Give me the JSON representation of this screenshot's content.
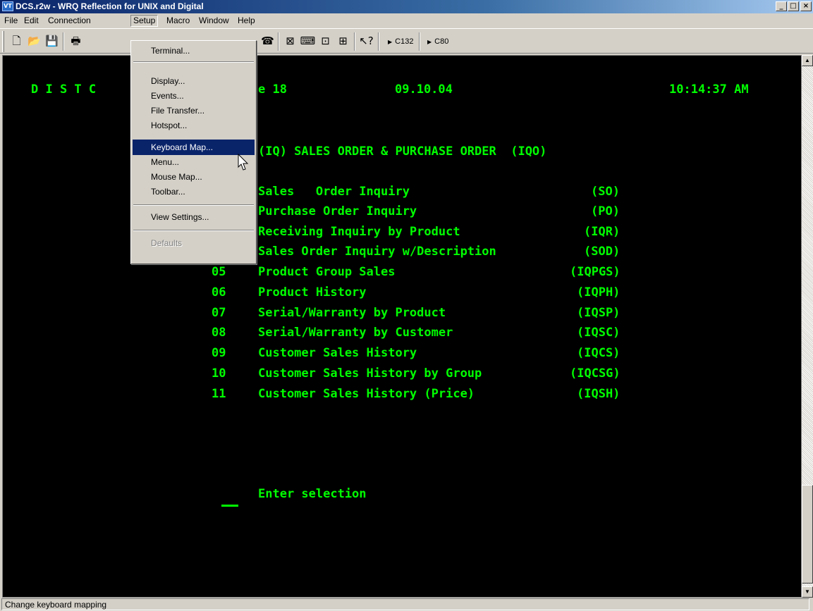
{
  "window": {
    "title": "DCS.r2w - WRQ Reflection for UNIX and Digital",
    "app_icon_text": "VT",
    "minimize": "_",
    "maximize": "□",
    "close": "×"
  },
  "menubar": [
    "File",
    "Edit",
    "Connection",
    "Setup",
    "Macro",
    "Window",
    "Help"
  ],
  "toolbar": {
    "buttons": [
      "new-icon",
      "open-icon",
      "save-icon",
      "print-icon",
      "connect-icon",
      "hotspot-icon",
      "keyboard-icon",
      "display-icon",
      "mouse-icon",
      "window-icon",
      "help-icon"
    ],
    "c132_label": "C132",
    "c80_label": "C80"
  },
  "setup_menu": {
    "items": [
      {
        "label": "Terminal..."
      },
      {
        "label": "Display..."
      },
      {
        "label": "Events..."
      },
      {
        "label": "File Transfer..."
      },
      {
        "label": "Hotspot..."
      },
      {
        "label": "Keyboard Map..."
      },
      {
        "label": "Menu..."
      },
      {
        "label": "Mouse Map..."
      },
      {
        "label": "Toolbar..."
      },
      {
        "label": "View Settings..."
      },
      {
        "label": "Defaults"
      }
    ],
    "active": "Keyboard Map..."
  },
  "terminal": {
    "header_left": "D I S T C",
    "header_mid": "e 18",
    "date": "09.10.04",
    "time": "10:14:37 AM",
    "menu_title": "(IQ) SALES ORDER & PURCHASE ORDER  (IQO)",
    "options": [
      {
        "num": "",
        "label": "Sales   Order Inquiry",
        "code": "(SO)"
      },
      {
        "num": "",
        "label": "Purchase Order Inquiry",
        "code": "(PO)"
      },
      {
        "num": "",
        "label": "Receiving Inquiry by Product",
        "code": "(IQR)"
      },
      {
        "num": "",
        "label": "Sales Order Inquiry w/Description",
        "code": "(SOD)"
      },
      {
        "num": "05",
        "label": "Product Group Sales",
        "code": "(IQPGS)"
      },
      {
        "num": "06",
        "label": "Product History",
        "code": "(IQPH)"
      },
      {
        "num": "07",
        "label": "Serial/Warranty by Product",
        "code": "(IQSP)"
      },
      {
        "num": "08",
        "label": "Serial/Warranty by Customer",
        "code": "(IQSC)"
      },
      {
        "num": "09",
        "label": "Customer Sales History",
        "code": "(IQCS)"
      },
      {
        "num": "10",
        "label": "Customer Sales History by Group",
        "code": "(IQCSG)"
      },
      {
        "num": "11",
        "label": "Customer Sales History (Price)",
        "code": "(IQSH)"
      }
    ],
    "prompt": "Enter selection",
    "text_color": "#00ff00"
  },
  "statusbar": {
    "text": "Change keyboard mapping"
  }
}
